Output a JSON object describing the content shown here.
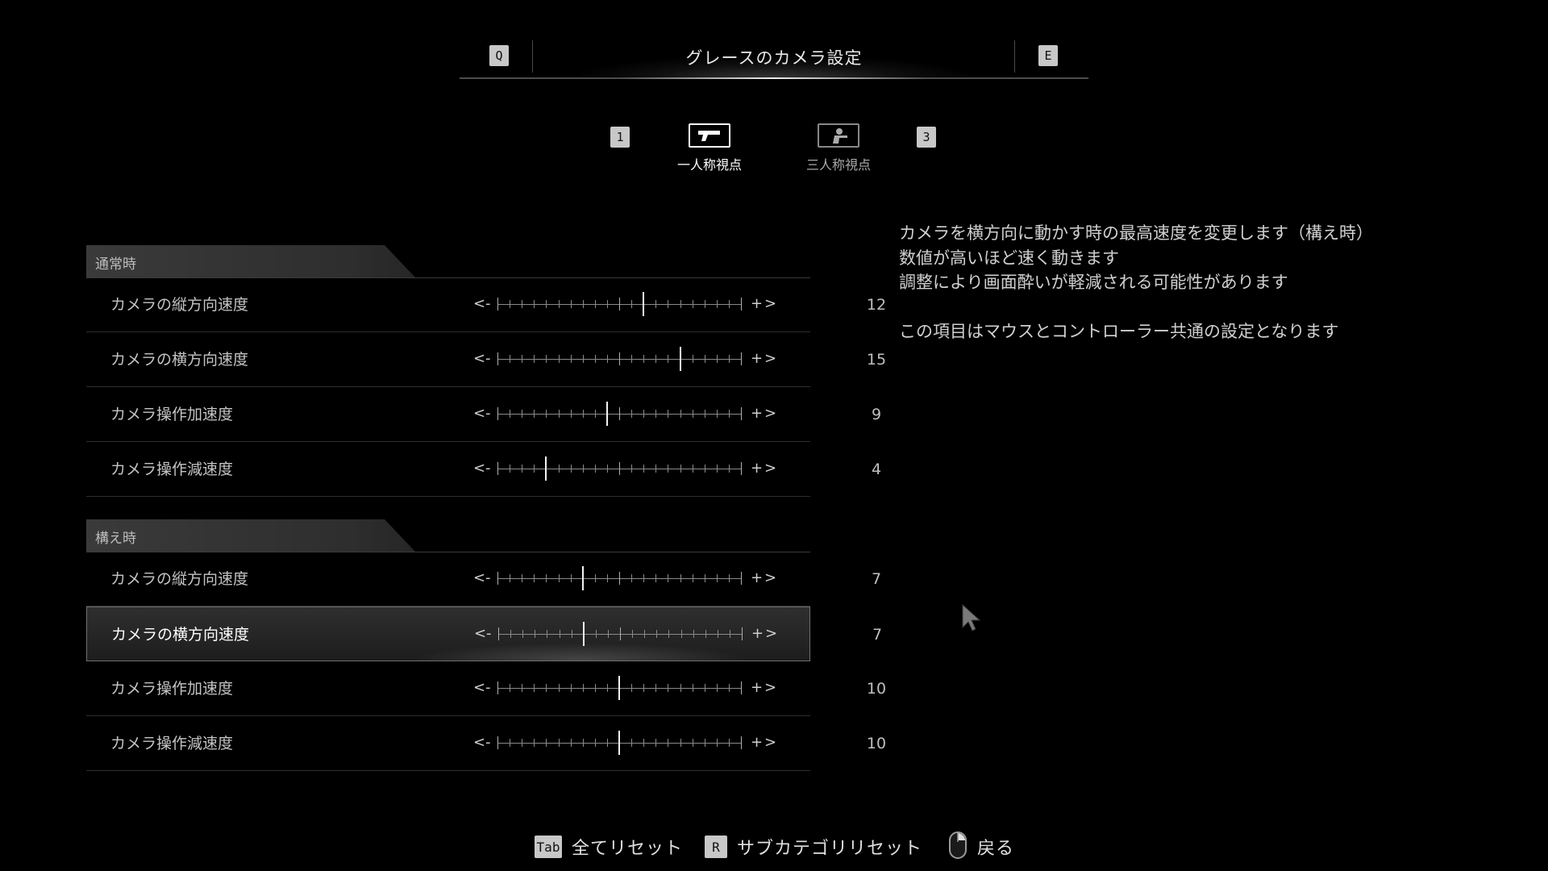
{
  "header": {
    "title": "グレースのカメラ設定",
    "prev_key": "Q",
    "next_key": "E"
  },
  "view_tabs": {
    "prev_key": "1",
    "next_key": "3",
    "items": [
      {
        "label": "一人称視点",
        "icon": "pistol-icon",
        "active": true
      },
      {
        "label": "三人称視点",
        "icon": "aiming-character-icon",
        "active": false
      }
    ]
  },
  "sections": [
    {
      "title": "通常時",
      "rows": [
        {
          "label": "カメラの縦方向速度",
          "value": "12"
        },
        {
          "label": "カメラの横方向速度",
          "value": "15"
        },
        {
          "label": "カメラ操作加速度",
          "value": "9"
        },
        {
          "label": "カメラ操作減速度",
          "value": "4"
        }
      ]
    },
    {
      "title": "構え時",
      "rows": [
        {
          "label": "カメラの縦方向速度",
          "value": "7"
        },
        {
          "label": "カメラの横方向速度",
          "value": "7",
          "selected": true
        },
        {
          "label": "カメラ操作加速度",
          "value": "10"
        },
        {
          "label": "カメラ操作減速度",
          "value": "10"
        }
      ]
    }
  ],
  "slider": {
    "decrease_arrow": "<",
    "decrease_sign": "-",
    "increase_sign": "+",
    "increase_arrow": ">",
    "min": 0,
    "max": 20
  },
  "description": {
    "lines": [
      "カメラを横方向に動かす時の最高速度を変更します（構え時）",
      "数値が高いほど速く動きます",
      "調整により画面酔いが軽減される可能性があります"
    ],
    "note": "この項目はマウスとコントローラー共通の設定となります"
  },
  "footer": {
    "reset_all": {
      "key": "Tab",
      "label": "全てリセット"
    },
    "reset_sub": {
      "key": "R",
      "label": "サブカテゴリリセット"
    },
    "back": {
      "icon": "mouse-right-click-icon",
      "label": "戻る"
    }
  },
  "colors": {
    "background": "#000000",
    "text": "#c9c9c9",
    "highlight": "#ffffff",
    "key_bg": "#c8c8c8"
  }
}
